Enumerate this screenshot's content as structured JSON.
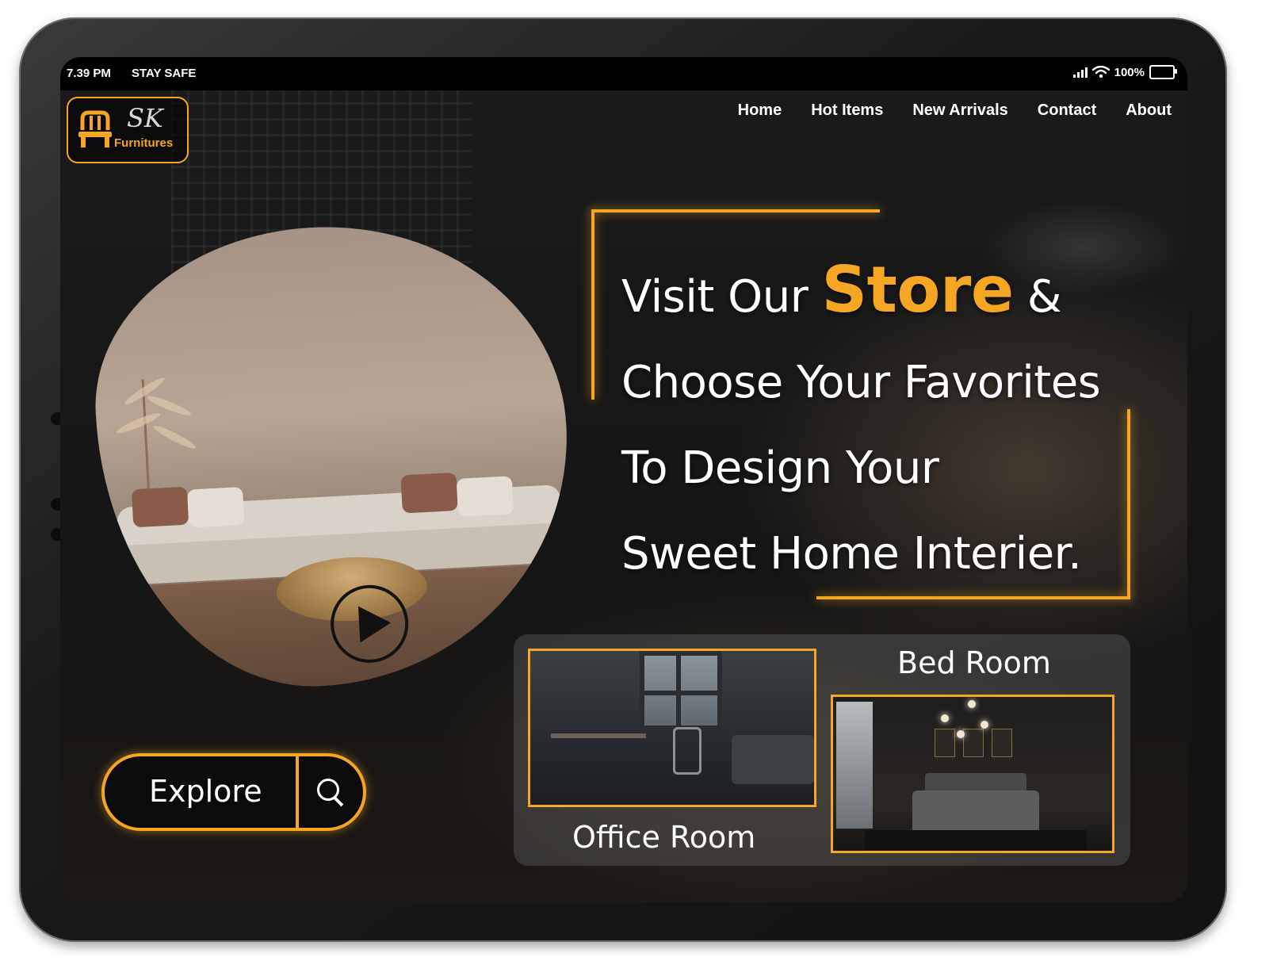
{
  "status_bar": {
    "time": "7.39 PM",
    "message": "STAY SAFE",
    "battery": "100%",
    "battery_level": 1.0
  },
  "brand": {
    "logo_mark": "SK",
    "logo_text": "Furnitures",
    "accent_color": "#f5a623"
  },
  "nav": {
    "items": [
      {
        "label": "Home"
      },
      {
        "label": "Hot Items"
      },
      {
        "label": "New Arrivals"
      },
      {
        "label": "Contact"
      },
      {
        "label": "About"
      }
    ]
  },
  "hero": {
    "line1_prefix": "Visit Our",
    "line1_accent": "Store",
    "line1_suffix": "&",
    "line2": "Choose Your Favorites",
    "line3": "To Design Your",
    "line4": "Sweet Home Interier."
  },
  "explore": {
    "label": "Explore",
    "search_icon": "search-icon"
  },
  "media": {
    "play_icon": "play-icon"
  },
  "rooms": [
    {
      "label": "Office Room"
    },
    {
      "label": "Bed Room"
    }
  ]
}
